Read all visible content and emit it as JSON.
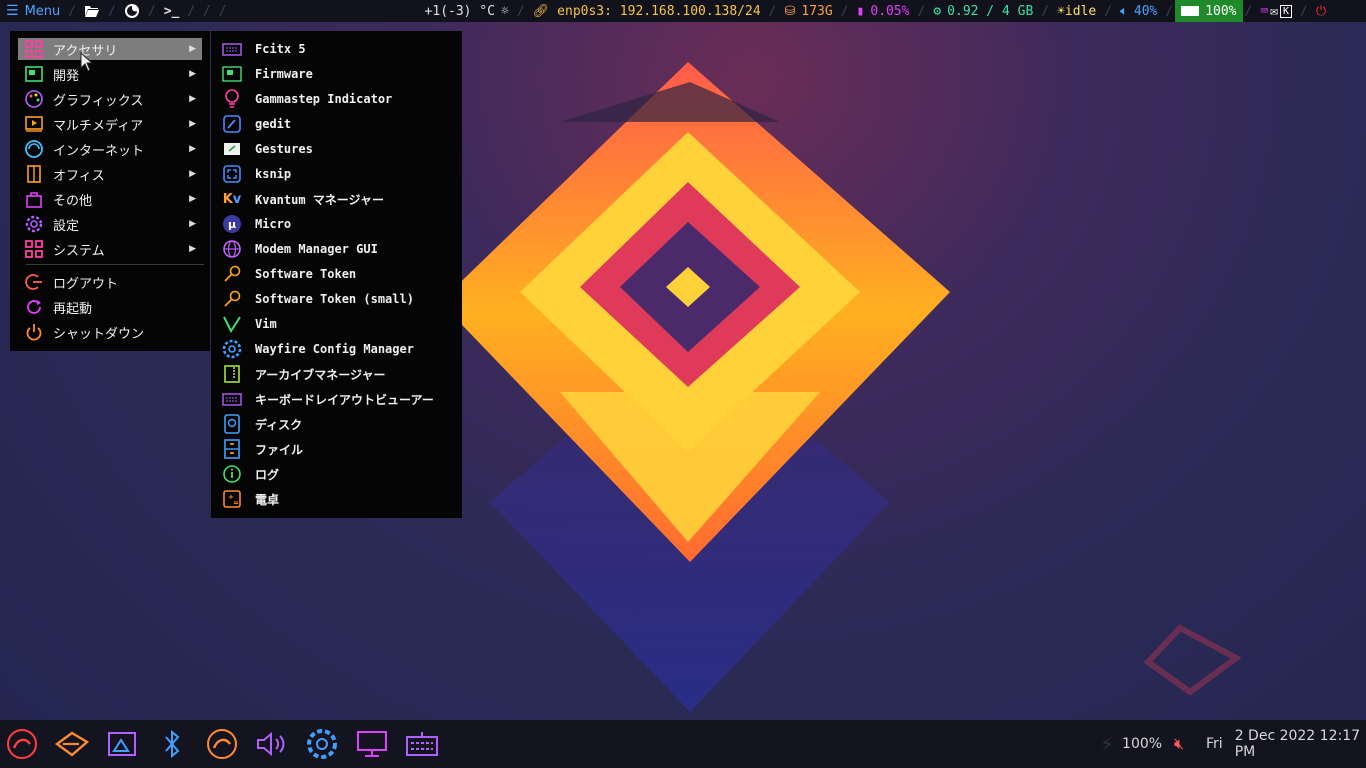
{
  "topbar": {
    "menu_label": "Menu",
    "temperature": "+1(-3) °C",
    "network": "enp0s3: 192.168.100.138/24",
    "disk": "173G",
    "cpu": "0.05%",
    "memory": "0.92 / 4 GB",
    "idle": "idle",
    "volume": "40%",
    "battery": "100%",
    "colors": {
      "accent": "#4aa3ff",
      "network": "#f5c542",
      "disk": "#ff9f40",
      "cpu": "#e040fb",
      "memory": "#40e0a0",
      "idle": "#ffe066",
      "volume": "#4aa3ff",
      "battery_bg": "#1f8a2a",
      "power": "#ff3030"
    }
  },
  "main_menu": {
    "items": [
      {
        "label": "アクセサリ",
        "icon": "accessories-grid-icon"
      },
      {
        "label": "開発",
        "icon": "development-icon"
      },
      {
        "label": "グラフィックス",
        "icon": "graphics-palette-icon"
      },
      {
        "label": "マルチメディア",
        "icon": "multimedia-icon"
      },
      {
        "label": "インターネット",
        "icon": "internet-icon"
      },
      {
        "label": "オフィス",
        "icon": "office-icon"
      },
      {
        "label": "その他",
        "icon": "other-bag-icon"
      },
      {
        "label": "設定",
        "icon": "settings-gear-icon"
      },
      {
        "label": "システム",
        "icon": "system-grid-icon"
      }
    ],
    "actions": [
      {
        "label": "ログアウト",
        "icon": "logout-icon"
      },
      {
        "label": "再起動",
        "icon": "reboot-icon"
      },
      {
        "label": "シャットダウン",
        "icon": "shutdown-icon"
      }
    ]
  },
  "submenu": {
    "items": [
      {
        "label": "Fcitx 5",
        "icon": "keyboard-icon"
      },
      {
        "label": "Firmware",
        "icon": "firmware-board-icon"
      },
      {
        "label": "Gammastep Indicator",
        "icon": "lightbulb-icon"
      },
      {
        "label": "gedit",
        "icon": "text-editor-icon"
      },
      {
        "label": "Gestures",
        "icon": "gestures-icon"
      },
      {
        "label": "ksnip",
        "icon": "screenshot-icon"
      },
      {
        "label": "Kvantum マネージャー",
        "icon": "kvantum-icon"
      },
      {
        "label": "Micro",
        "icon": "micro-icon"
      },
      {
        "label": "Modem Manager GUI",
        "icon": "globe-icon"
      },
      {
        "label": "Software Token",
        "icon": "key-icon"
      },
      {
        "label": "Software Token (small)",
        "icon": "key-small-icon"
      },
      {
        "label": "Vim",
        "icon": "vim-icon"
      },
      {
        "label": "Wayfire Config Manager",
        "icon": "wayfire-gear-icon"
      },
      {
        "label": "アーカイブマネージャー",
        "icon": "archive-icon"
      },
      {
        "label": "キーボードレイアウトビューアー",
        "icon": "keyboard-layout-icon"
      },
      {
        "label": "ディスク",
        "icon": "disk-icon"
      },
      {
        "label": "ファイル",
        "icon": "file-cabinet-icon"
      },
      {
        "label": "ログ",
        "icon": "log-icon"
      },
      {
        "label": "電卓",
        "icon": "calculator-icon"
      }
    ]
  },
  "tray": {
    "brightness": "100%",
    "day": "Fri",
    "datetime": "2 Dec 2022 12:17 PM"
  }
}
